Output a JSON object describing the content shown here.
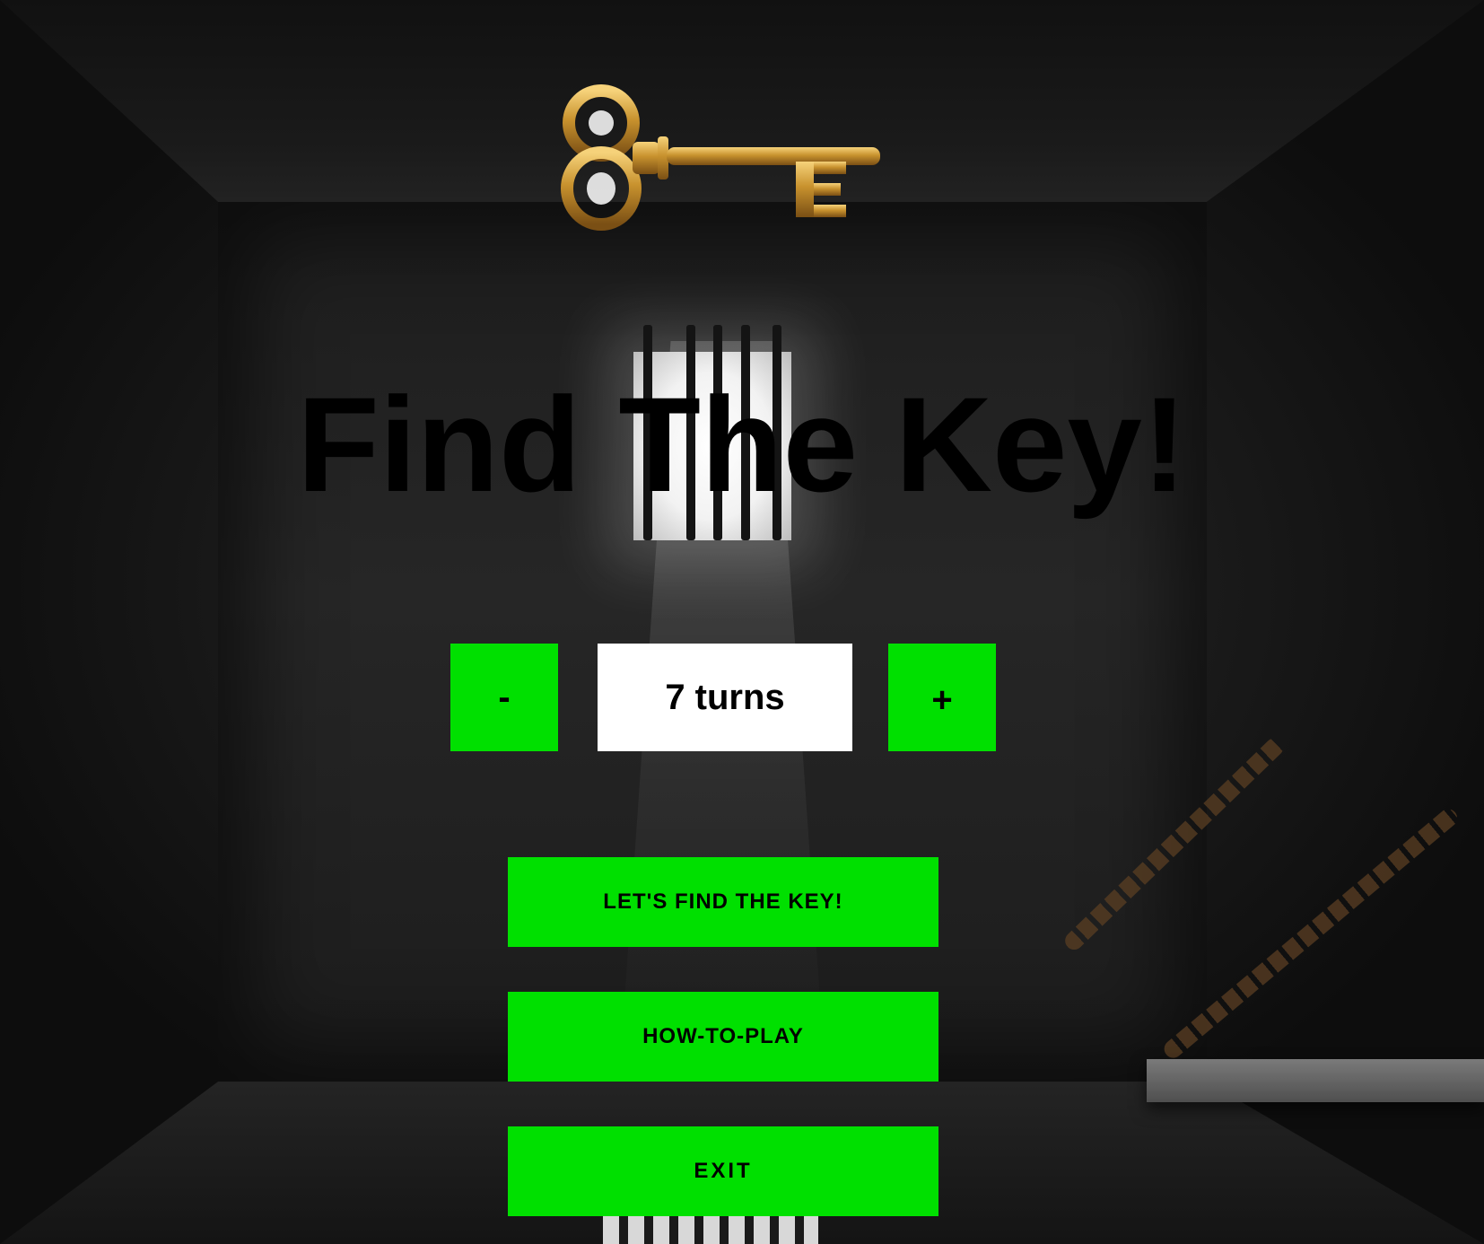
{
  "title": "Find The Key!",
  "turns": {
    "decrement_label": "-",
    "value_label": "7 turns",
    "increment_label": "+"
  },
  "menu": {
    "start_label": "LET'S FIND THE KEY!",
    "howto_label": "HOW-TO-PLAY",
    "exit_label": "EXIT"
  },
  "icons": {
    "key": "golden-key-icon"
  },
  "colors": {
    "button_green": "#00e000",
    "display_white": "#ffffff",
    "title_black": "#000000",
    "key_gold": "#c8922e"
  }
}
